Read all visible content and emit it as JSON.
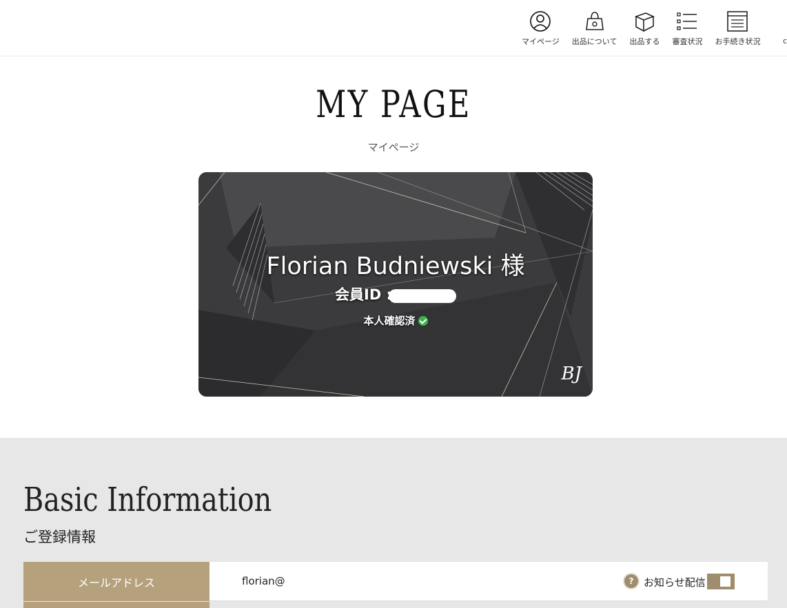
{
  "nav": {
    "items": [
      {
        "label": "マイページ",
        "icon": "user-circle-icon"
      },
      {
        "label": "出品について",
        "icon": "bag-icon"
      },
      {
        "label": "出品する",
        "icon": "box-icon"
      },
      {
        "label": "審査状況",
        "icon": "list-icon"
      },
      {
        "label": "お手続き状況",
        "icon": "document-list-icon"
      }
    ],
    "overflow": "c"
  },
  "page": {
    "title": "MY PAGE",
    "subtitle": "マイページ"
  },
  "card": {
    "name": "Florian Budniewski 様",
    "member_id_label": "会員ID :",
    "verified": "本人確認済",
    "logo": "BJ"
  },
  "basic": {
    "title": "Basic Information",
    "subtitle": "ご登録情報",
    "email_label": "メールアドレス",
    "email_value": "florian@",
    "notification_label": "お知らせ配信",
    "help": "?"
  },
  "colors": {
    "accent": "#b6a17d",
    "toggle": "#a08d6d",
    "section_bg": "#e7e7e7",
    "card_bg": "#3d3d3f",
    "verified": "#3bb54a"
  }
}
